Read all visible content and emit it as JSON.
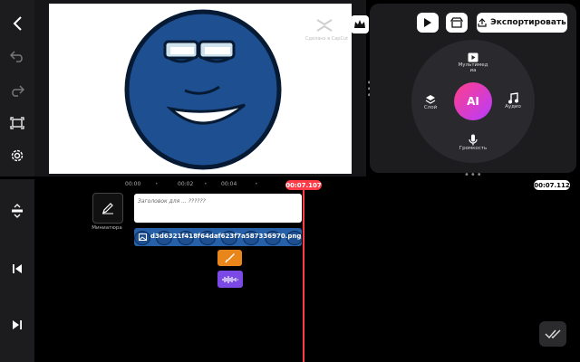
{
  "watermark": {
    "text": "Сделано в CapCut"
  },
  "header": {
    "export_label": "Экспортировать"
  },
  "wheel": {
    "ai_label": "AI",
    "items": {
      "multimedia": "Мультимедиа",
      "layer": "Слой",
      "audio": "Аудио",
      "volume": "Громкость"
    }
  },
  "timeline": {
    "ruler": [
      "00:00",
      "00:02",
      "00:04"
    ],
    "current_time": "00:07.107",
    "total_time": "00:07.112",
    "thumbnail_label": "Миниатюра",
    "text_clip_label": "Заголовок для ... ??????",
    "image_clip_label": "d3d6321f418f64daf623f7a587336970.png"
  },
  "colors": {
    "accent": "#ff3b47",
    "face_blue": "#1e4f90",
    "orange_clip": "#e9861b",
    "purple_clip": "#7a49e6"
  }
}
